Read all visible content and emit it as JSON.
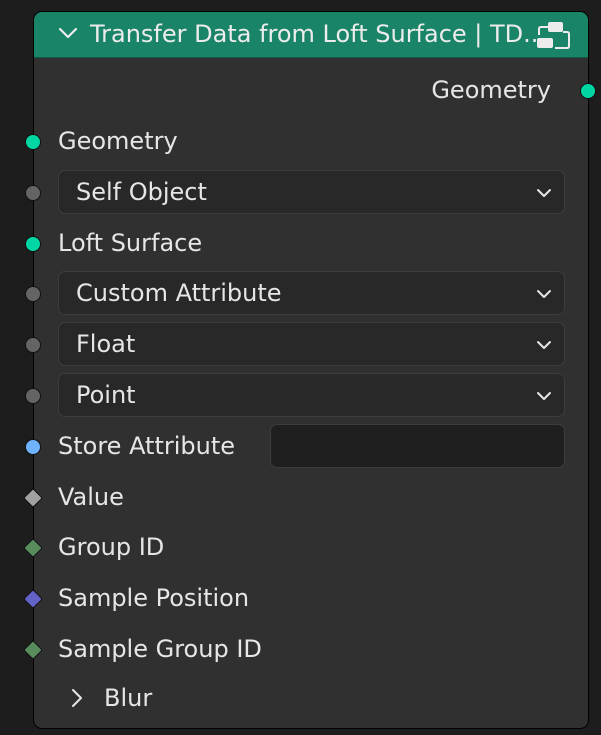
{
  "node": {
    "title": "Transfer Data from Loft Surface | TD...",
    "output_label": "Geometry",
    "inputs": {
      "geometry": "Geometry",
      "self_object": "Self Object",
      "loft_surface": "Loft Surface",
      "custom_attribute": "Custom Attribute",
      "float": "Float",
      "point": "Point",
      "store_attribute": "Store Attribute",
      "store_attribute_value": "",
      "value": "Value",
      "group_id": "Group ID",
      "sample_position": "Sample Position",
      "sample_group_id": "Sample Group ID"
    },
    "panel_blur": "Blur"
  },
  "colors": {
    "header": "#1a8468",
    "geometry_socket": "#00d6a3",
    "grey_socket": "#646464",
    "string_socket": "#6fb3ff",
    "float_socket": "#a1a1a1",
    "int_socket": "#598c5c",
    "vector_socket": "#6363c7"
  },
  "icons": {
    "collapse": "chevron-down-icon",
    "node_group": "node-group-icon",
    "dropdown": "chevron-down-icon",
    "panel": "chevron-right-icon"
  }
}
